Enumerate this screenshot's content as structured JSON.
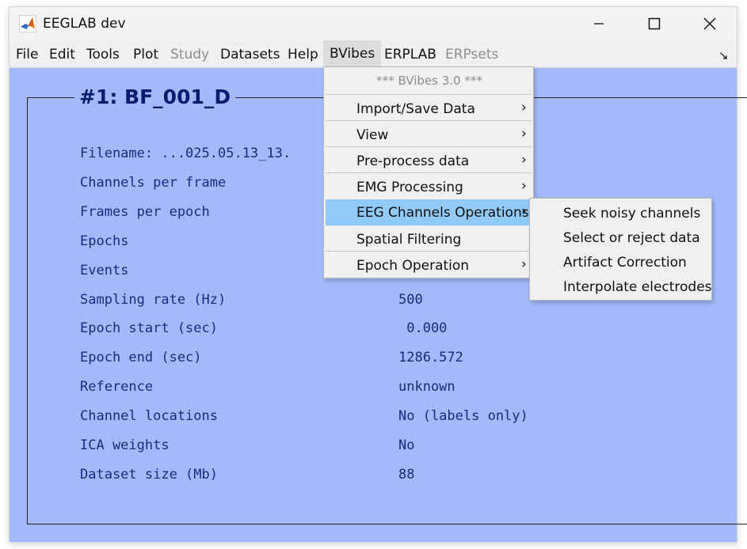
{
  "window": {
    "title": "EEGLAB dev"
  },
  "menubar": {
    "items": [
      {
        "label": "File"
      },
      {
        "label": "Edit"
      },
      {
        "label": "Tools"
      },
      {
        "label": "Plot"
      },
      {
        "label": "Study"
      },
      {
        "label": "Datasets"
      },
      {
        "label": "Help"
      },
      {
        "label": "BVibes"
      },
      {
        "label": "ERPLAB"
      },
      {
        "label": "ERPsets"
      }
    ],
    "overflow_icon": "arrow-icon"
  },
  "dataset": {
    "title": "#1: BF_001_D",
    "rows": [
      {
        "label": "Filename: ...025.05.13_13.",
        "value": ""
      },
      {
        "label": "Channels per frame",
        "value": ""
      },
      {
        "label": "Frames per epoch",
        "value": ""
      },
      {
        "label": "Epochs",
        "value": ""
      },
      {
        "label": "Events",
        "value": ""
      },
      {
        "label": "Sampling rate (Hz)",
        "value": "500"
      },
      {
        "label": "Epoch start (sec)",
        "value": " 0.000"
      },
      {
        "label": "Epoch end (sec)",
        "value": "1286.572"
      },
      {
        "label": "Reference",
        "value": "unknown"
      },
      {
        "label": "Channel locations",
        "value": "No (labels only)"
      },
      {
        "label": "ICA weights",
        "value": "No"
      },
      {
        "label": "Dataset size (Mb)",
        "value": "88"
      }
    ]
  },
  "bvibes_menu": {
    "header": "*** BVibes 3.0 ***",
    "items": [
      {
        "label": "Import/Save Data",
        "submenu": true
      },
      {
        "label": "View",
        "submenu": true
      },
      {
        "label": "Pre-process data",
        "submenu": true
      },
      {
        "label": "EMG Processing",
        "submenu": true
      },
      {
        "label": "EEG Channels Operations",
        "submenu": true
      },
      {
        "label": "Spatial Filtering",
        "submenu": false
      },
      {
        "label": "Epoch Operation",
        "submenu": true
      }
    ]
  },
  "eeg_channels_submenu": {
    "items": [
      {
        "label": "Seek noisy channels"
      },
      {
        "label": "Select or reject data"
      },
      {
        "label": "Artifact Correction"
      },
      {
        "label": "Interpolate electrodes"
      }
    ]
  },
  "colors": {
    "content_bg": "#a3b9fb",
    "text_navy": "#1a2a80",
    "highlight": "#91c9f7"
  }
}
